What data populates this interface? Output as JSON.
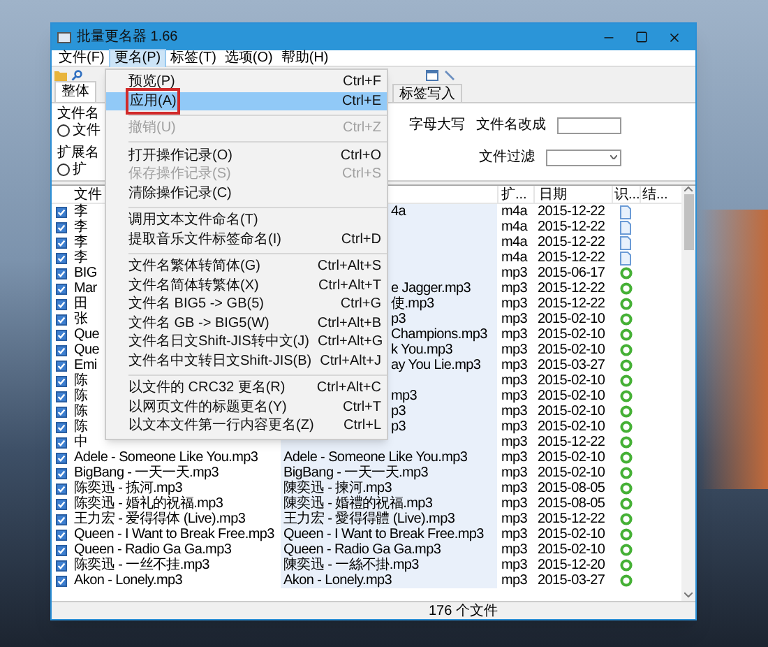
{
  "window": {
    "title": "批量更名器 1.66"
  },
  "menu_bar": [
    {
      "label": "文件(F)",
      "selected": false
    },
    {
      "label": "更名(P)",
      "selected": true
    },
    {
      "label": "标签(T)",
      "selected": false
    },
    {
      "label": "选项(O)",
      "selected": false
    },
    {
      "label": "帮助(H)",
      "selected": false
    }
  ],
  "rename_menu": [
    {
      "kind": "item",
      "label": "预览(P)",
      "shortcut": "Ctrl+F",
      "disabled": false,
      "selected": false
    },
    {
      "kind": "item",
      "label": "应用(A)",
      "shortcut": "Ctrl+E",
      "disabled": false,
      "selected": true
    },
    {
      "kind": "separator"
    },
    {
      "kind": "item",
      "label": "撤销(U)",
      "shortcut": "Ctrl+Z",
      "disabled": true,
      "selected": false
    },
    {
      "kind": "separator"
    },
    {
      "kind": "item",
      "label": "打开操作记录(O)",
      "shortcut": "Ctrl+O",
      "disabled": false,
      "selected": false
    },
    {
      "kind": "item",
      "label": "保存操作记录(S)",
      "shortcut": "Ctrl+S",
      "disabled": true,
      "selected": false
    },
    {
      "kind": "item",
      "label": "清除操作记录(C)",
      "disabled": false,
      "selected": false
    },
    {
      "kind": "separator"
    },
    {
      "kind": "item",
      "label": "调用文本文件命名(T)",
      "disabled": false,
      "selected": false
    },
    {
      "kind": "item",
      "label": "提取音乐文件标签命名(I)",
      "shortcut": "Ctrl+D",
      "disabled": false,
      "selected": false
    },
    {
      "kind": "separator"
    },
    {
      "kind": "item",
      "label": "文件名繁体转简体(G)",
      "shortcut": "Ctrl+Alt+S",
      "disabled": false,
      "selected": false
    },
    {
      "kind": "item",
      "label": "文件名简体转繁体(X)",
      "shortcut": "Ctrl+Alt+T",
      "disabled": false,
      "selected": false
    },
    {
      "kind": "item",
      "label": "文件名 BIG5 -> GB(5)",
      "shortcut": "Ctrl+G",
      "disabled": false,
      "selected": false
    },
    {
      "kind": "item",
      "label": "文件名 GB -> BIG5(W)",
      "shortcut": "Ctrl+Alt+B",
      "disabled": false,
      "selected": false
    },
    {
      "kind": "item",
      "label": "文件名日文Shift-JIS转中文(J)",
      "shortcut": "Ctrl+Alt+G",
      "disabled": false,
      "selected": false
    },
    {
      "kind": "item",
      "label": "文件名中文转日文Shift-JIS(B)",
      "shortcut": "Ctrl+Alt+J",
      "disabled": false,
      "selected": false
    },
    {
      "kind": "separator"
    },
    {
      "kind": "item",
      "label": "以文件的 CRC32 更名(R)",
      "shortcut": "Ctrl+Alt+C",
      "disabled": false,
      "selected": false
    },
    {
      "kind": "item",
      "label": "以网页文件的标题更名(Y)",
      "shortcut": "Ctrl+T",
      "disabled": false,
      "selected": false
    },
    {
      "kind": "item",
      "label": "以文本文件第一行内容更名(Z)",
      "shortcut": "Ctrl+L",
      "disabled": false,
      "selected": false
    }
  ],
  "tabs": [
    {
      "label": "整体",
      "selected": true
    },
    {
      "label": "标签写入",
      "selected": false
    }
  ],
  "options": {
    "filename_label": "文件名",
    "filename_radio": {
      "label": "文件",
      "selected": false
    },
    "uppercase_label": "字母大写",
    "rename_to_label": "文件名改成",
    "extension_label": "扩展名",
    "extension_radio": {
      "label": "扩",
      "selected": false
    },
    "filter_label": "文件过滤"
  },
  "table": {
    "columns": {
      "name": "文件",
      "ext": "扩...",
      "date": "日期",
      "column_5": "识...",
      "column_6": "结..."
    },
    "rows": [
      {
        "checked": true,
        "name": "李",
        "new_name": "4a",
        "ext": "m4a",
        "date": "2015-12-22",
        "kind": "document"
      },
      {
        "checked": true,
        "name": "李",
        "ext": "m4a",
        "date": "2015-12-22",
        "kind": "document"
      },
      {
        "checked": true,
        "name": "李",
        "ext": "m4a",
        "date": "2015-12-22",
        "kind": "document"
      },
      {
        "checked": true,
        "name": "李",
        "ext": "m4a",
        "date": "2015-12-22",
        "kind": "document"
      },
      {
        "checked": true,
        "name": "BIG",
        "ext": "mp3",
        "date": "2015-06-17",
        "kind": "ok"
      },
      {
        "checked": true,
        "name": "Mar",
        "new_name": "e Jagger.mp3",
        "ext": "mp3",
        "date": "2015-12-22",
        "kind": "ok"
      },
      {
        "checked": true,
        "name": "田",
        "new_name": "使.mp3",
        "ext": "mp3",
        "date": "2015-12-22",
        "kind": "ok"
      },
      {
        "checked": true,
        "name": "张",
        "new_name": "p3",
        "ext": "mp3",
        "date": "2015-02-10",
        "kind": "ok"
      },
      {
        "checked": true,
        "name": "Que",
        "new_name": "Champions.mp3",
        "ext": "mp3",
        "date": "2015-02-10",
        "kind": "ok"
      },
      {
        "checked": true,
        "name": "Que",
        "new_name": "k You.mp3",
        "ext": "mp3",
        "date": "2015-02-10",
        "kind": "ok"
      },
      {
        "checked": true,
        "name": "Emi",
        "new_name": "ay You Lie.mp3",
        "ext": "mp3",
        "date": "2015-03-27",
        "kind": "ok"
      },
      {
        "checked": true,
        "name": "陈",
        "ext": "mp3",
        "date": "2015-02-10",
        "kind": "ok"
      },
      {
        "checked": true,
        "name": "陈",
        "new_name": "mp3",
        "ext": "mp3",
        "date": "2015-02-10",
        "kind": "ok"
      },
      {
        "checked": true,
        "name": "陈",
        "new_name": "p3",
        "ext": "mp3",
        "date": "2015-02-10",
        "kind": "ok"
      },
      {
        "checked": true,
        "name": "陈",
        "new_name": "p3",
        "ext": "mp3",
        "date": "2015-02-10",
        "kind": "ok"
      },
      {
        "checked": true,
        "name": "中",
        "ext": "mp3",
        "date": "2015-12-22",
        "kind": "ok"
      },
      {
        "checked": true,
        "name": "Adele - Someone Like You.mp3",
        "new_name": "Adele - Someone Like You.mp3",
        "ext": "mp3",
        "date": "2015-02-10",
        "kind": "ok"
      },
      {
        "checked": true,
        "name": "BigBang - 一天一天.mp3",
        "new_name": "BigBang - 一天一天.mp3",
        "ext": "mp3",
        "date": "2015-02-10",
        "kind": "ok"
      },
      {
        "checked": true,
        "name": "陈奕迅 - 拣河.mp3",
        "new_name": "陳奕迅 - 揀河.mp3",
        "ext": "mp3",
        "date": "2015-08-05",
        "kind": "ok"
      },
      {
        "checked": true,
        "name": "陈奕迅 - 婚礼的祝福.mp3",
        "new_name": "陳奕迅 - 婚禮的祝福.mp3",
        "ext": "mp3",
        "date": "2015-08-05",
        "kind": "ok"
      },
      {
        "checked": true,
        "name": "王力宏 - 爱得得体 (Live).mp3",
        "new_name": "王力宏 - 愛得得體 (Live).mp3",
        "ext": "mp3",
        "date": "2015-12-22",
        "kind": "ok"
      },
      {
        "checked": true,
        "name": "Queen - I Want to Break Free.mp3",
        "new_name": "Queen - I Want to Break Free.mp3",
        "ext": "mp3",
        "date": "2015-02-10",
        "kind": "ok"
      },
      {
        "checked": true,
        "name": "Queen - Radio Ga Ga.mp3",
        "new_name": "Queen - Radio Ga Ga.mp3",
        "ext": "mp3",
        "date": "2015-02-10",
        "kind": "ok"
      },
      {
        "checked": true,
        "name": "陈奕迅 - 一丝不挂.mp3",
        "new_name": "陳奕迅 - 一絲不掛.mp3",
        "ext": "mp3",
        "date": "2015-12-20",
        "kind": "ok"
      },
      {
        "checked": true,
        "name": "Akon - Lonely.mp3",
        "new_name": "Akon - Lonely.mp3",
        "ext": "mp3",
        "date": "2015-03-27",
        "kind": "ok"
      }
    ]
  },
  "status_bar": {
    "file_count": "176 个文件"
  }
}
